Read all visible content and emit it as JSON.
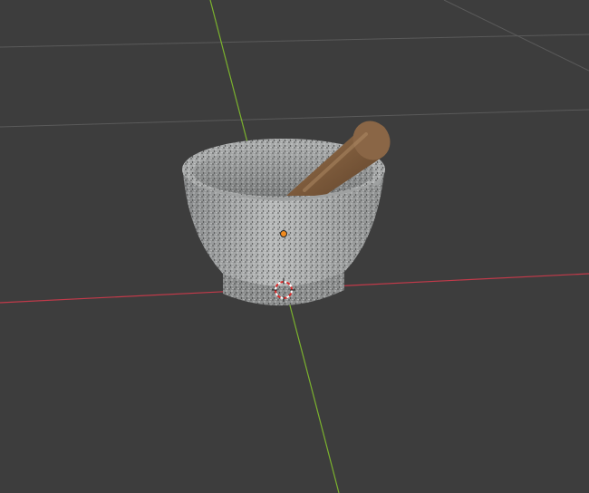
{
  "viewport": {
    "mode": "3d-viewport",
    "shading": "material-preview",
    "background_color": "#3d3d3d",
    "grid_color": "#5a5a5a",
    "x_axis_color": "#c23a4a",
    "y_axis_color": "#7bb22e"
  },
  "scene": {
    "objects": [
      {
        "name_icon": "mortar-icon",
        "material_color": "#8e9090"
      },
      {
        "name_icon": "pestle-icon",
        "material_color": "#7a5a3e"
      }
    ],
    "origin_marker": "orange-dot",
    "cursor": "3d-cursor-icon"
  }
}
